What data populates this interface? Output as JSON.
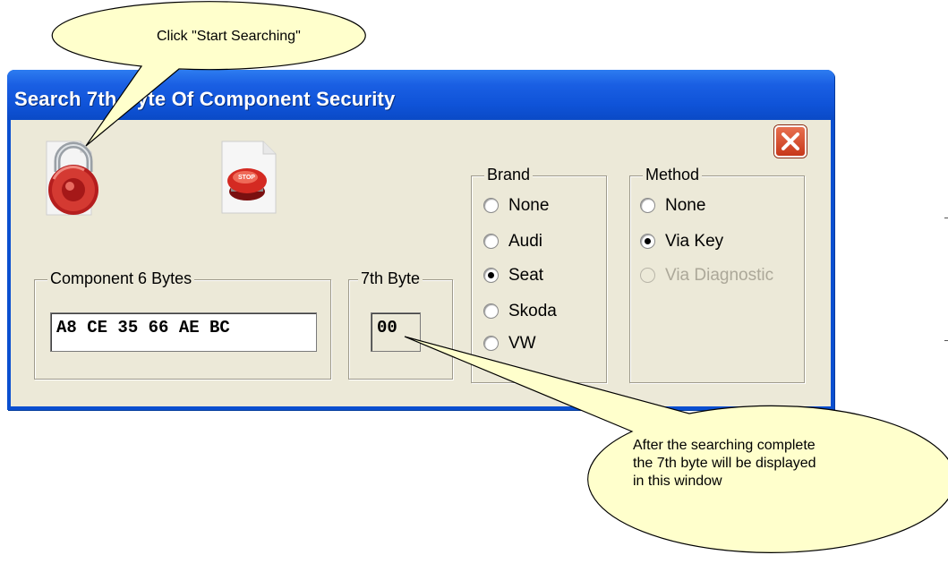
{
  "window": {
    "title": "Search 7th Byte Of Component Security"
  },
  "toolbar": {
    "start_icon": "padlock-icon",
    "stop_icon": "stop-button-icon",
    "close_icon": "close-icon"
  },
  "component_group": {
    "label": "Component 6 Bytes",
    "value": "A8 CE 35 66 AE BC"
  },
  "seventh_group": {
    "label": "7th Byte",
    "value": "00"
  },
  "brand": {
    "label": "Brand",
    "options": [
      "None",
      "Audi",
      "Seat",
      "Skoda",
      "VW"
    ],
    "selected": "Seat"
  },
  "method": {
    "label": "Method",
    "options": [
      "None",
      "Via Key",
      "Via Diagnostic"
    ],
    "selected": "Via Key",
    "disabled": [
      "Via Diagnostic"
    ]
  },
  "callouts": {
    "top": "Click \"Start Searching\"",
    "bottom": [
      "After the searching complete",
      "the 7th byte will be displayed",
      "in this window"
    ]
  },
  "colors": {
    "title_bar": "#0a4fd0",
    "client": "#ece9d8",
    "callout": "#ffffcc"
  }
}
